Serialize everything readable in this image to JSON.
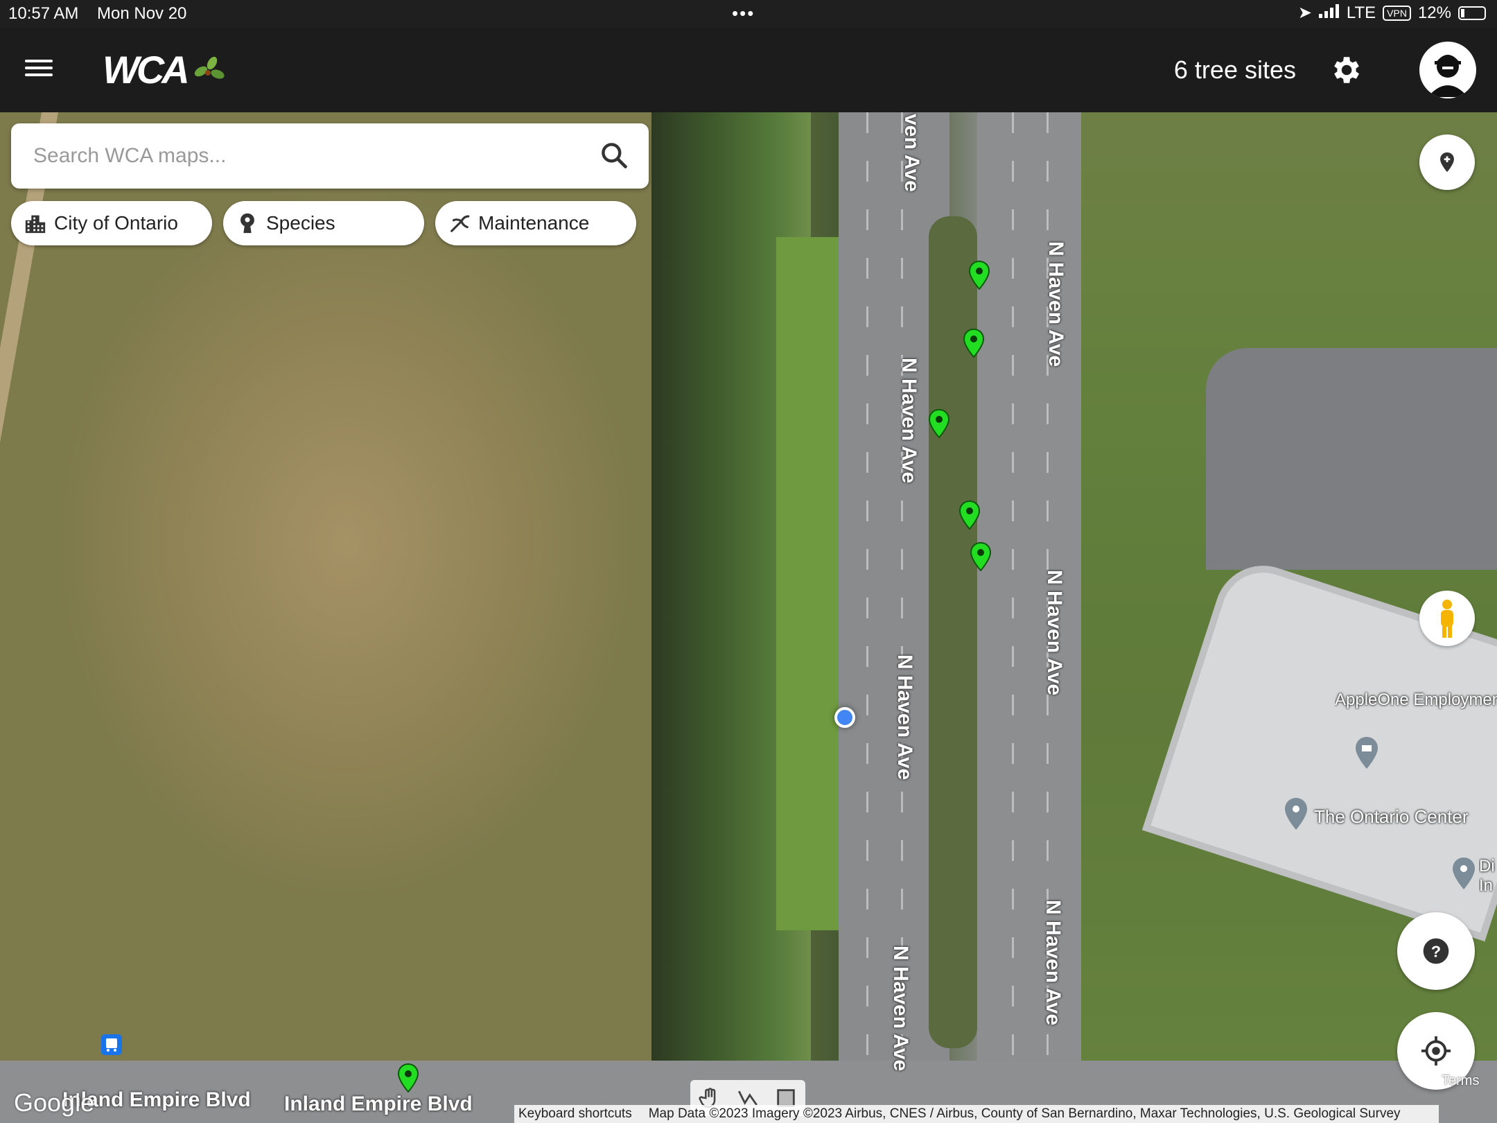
{
  "status_bar": {
    "time": "10:57 AM",
    "date": "Mon Nov 20",
    "network": "LTE",
    "vpn": "VPN",
    "battery": "12%"
  },
  "header": {
    "logo_text": "WCA",
    "tree_sites": "6 tree sites"
  },
  "search": {
    "placeholder": "Search WCA maps..."
  },
  "filters": [
    {
      "label": "City of Ontario",
      "icon": "city-icon"
    },
    {
      "label": "Species",
      "icon": "species-icon"
    },
    {
      "label": "Maintenance",
      "icon": "maintenance-icon"
    }
  ],
  "map": {
    "road_labels": {
      "haven_top": "ven Ave",
      "haven_1": "N Haven Ave",
      "haven_2": "N Haven Ave",
      "haven_3": "N Haven Ave",
      "haven_4": "N Haven Ave",
      "haven_5": "N Haven Ave",
      "haven_6": "N Haven Ave",
      "inland_1": "Inland Empire Blvd",
      "inland_2": "Inland Empire Blvd",
      "inland_3": "Inland Empi"
    },
    "pois": {
      "appleone": "AppleOne Employment Services - Ontario,",
      "ontario_center": "The Ontario Center",
      "partial": "Di In"
    },
    "marker_color": "#22dd22",
    "user_location_color": "#4285f4"
  },
  "attribution": {
    "logo": "Google",
    "shortcuts": "Keyboard shortcuts",
    "data": "Map Data ©2023 Imagery ©2023 Airbus, CNES / Airbus, County of San Bernardino, Maxar Technologies, U.S. Geological Survey",
    "terms": "Terms"
  },
  "fab": {
    "help": "?"
  }
}
